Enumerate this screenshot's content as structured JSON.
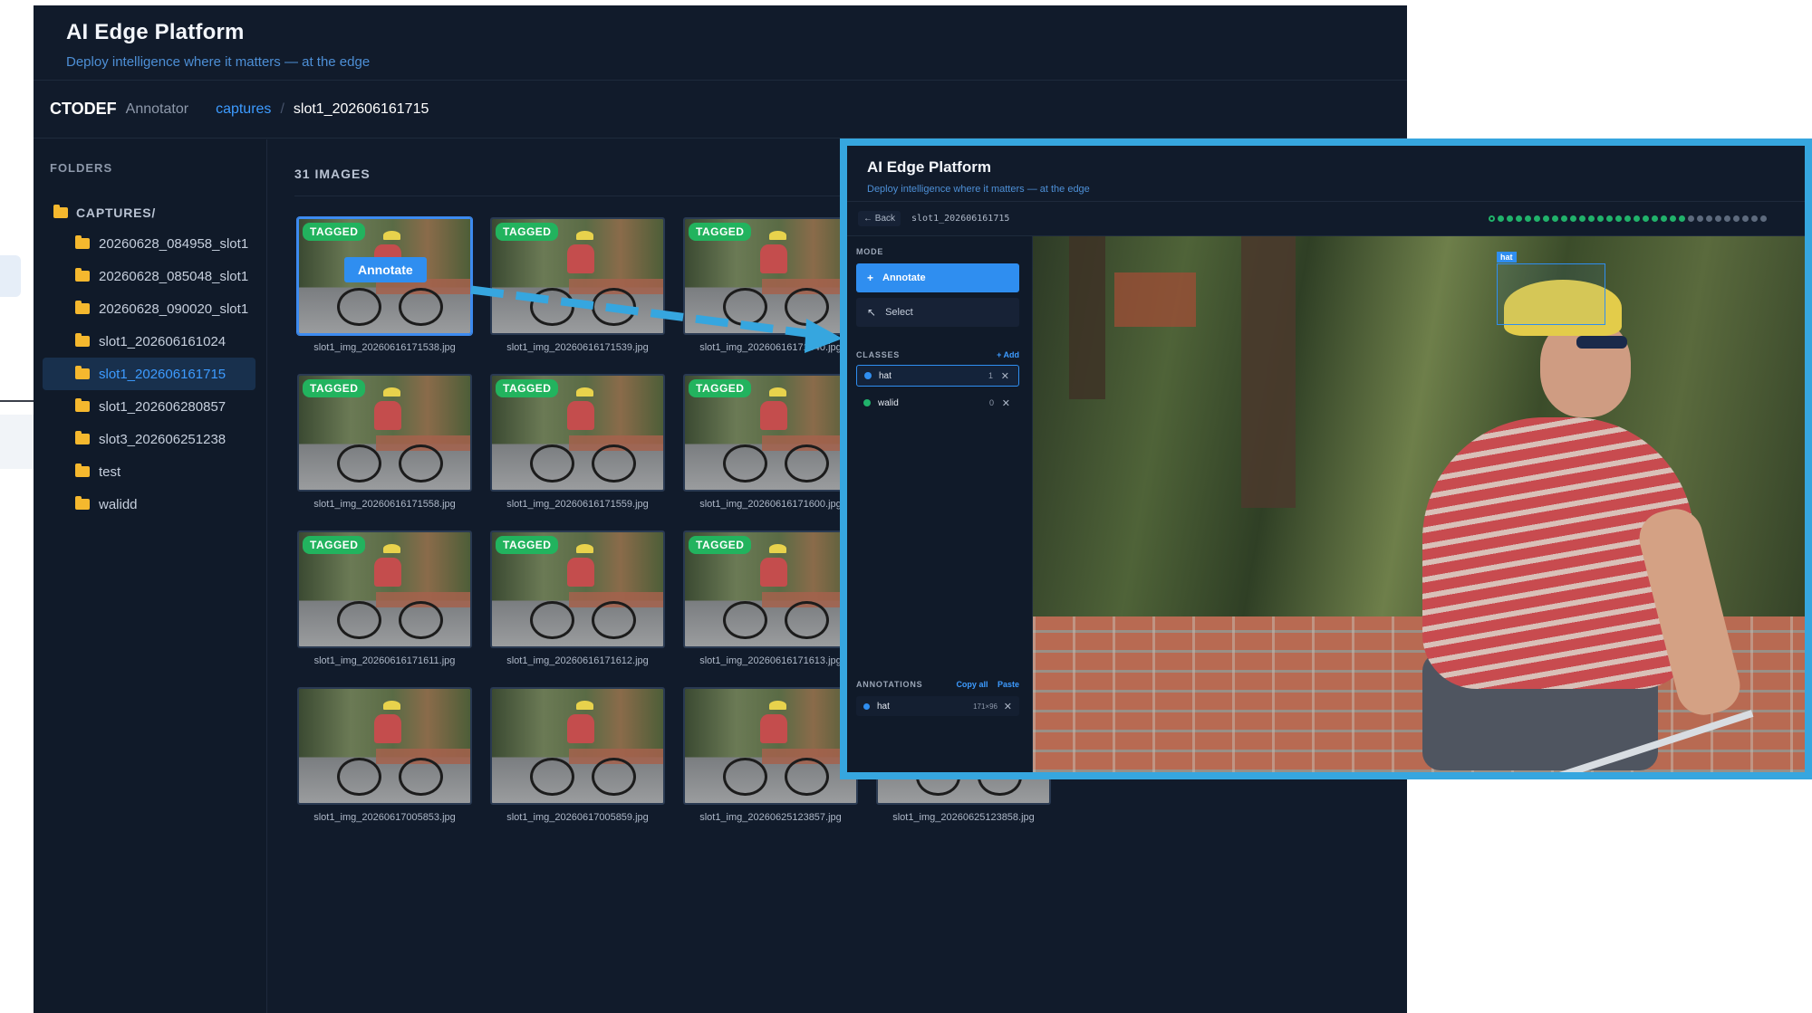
{
  "app": {
    "title": "AI Edge Platform",
    "subtitle": "Deploy intelligence where it matters — at the edge"
  },
  "crumbs": {
    "brand": "CTODEF",
    "brand_sub": "Annotator",
    "link": "captures",
    "separator": "/",
    "current": "slot1_202606161715"
  },
  "sidebar": {
    "heading": "FOLDERS",
    "root": "CAPTURES/",
    "folders": [
      {
        "label": "20260628_084958_slot1"
      },
      {
        "label": "20260628_085048_slot1"
      },
      {
        "label": "20260628_090020_slot1"
      },
      {
        "label": "slot1_202606161024"
      },
      {
        "label": "slot1_202606161715",
        "active": true
      },
      {
        "label": "slot1_202606280857"
      },
      {
        "label": "slot3_202606251238"
      },
      {
        "label": "test"
      },
      {
        "label": "walidd"
      }
    ]
  },
  "gallery": {
    "heading": "31 IMAGES",
    "badge": "TAGGED",
    "tooltip": "Annotate",
    "thumbs": [
      {
        "name": "slot1_img_20260616171538.jpg",
        "tagged": true
      },
      {
        "name": "slot1_img_20260616171539.jpg",
        "tagged": true
      },
      {
        "name": "slot1_img_20260616171540.jpg",
        "tagged": true
      },
      {
        "name": "",
        "tagged": false
      },
      {
        "name": "slot1_img_20260616171558.jpg",
        "tagged": true
      },
      {
        "name": "slot1_img_20260616171559.jpg",
        "tagged": true
      },
      {
        "name": "slot1_img_20260616171600.jpg",
        "tagged": true
      },
      {
        "name": "",
        "tagged": false
      },
      {
        "name": "slot1_img_20260616171611.jpg",
        "tagged": true
      },
      {
        "name": "slot1_img_20260616171612.jpg",
        "tagged": true
      },
      {
        "name": "slot1_img_20260616171613.jpg",
        "tagged": true
      },
      {
        "name": "",
        "tagged": false
      },
      {
        "name": "slot1_img_20260617005853.jpg",
        "tagged": false
      },
      {
        "name": "slot1_img_20260617005859.jpg",
        "tagged": false
      },
      {
        "name": "slot1_img_20260625123857.jpg",
        "tagged": false
      },
      {
        "name": "slot1_img_20260625123858.jpg",
        "tagged": false
      }
    ]
  },
  "annotator": {
    "title": "AI Edge Platform",
    "subtitle": "Deploy intelligence where it matters — at the edge",
    "back": "← Back",
    "slot": "slot1_202606161715",
    "progress_total": 31,
    "progress_done": 22,
    "progress_current": 0,
    "mode_heading": "MODE",
    "mode_annotate": "Annotate",
    "mode_select": "Select",
    "classes_heading": "CLASSES",
    "add_label": "+ Add",
    "classes": [
      {
        "name": "hat",
        "count": "1",
        "color": "#2f8ef0",
        "active": true
      },
      {
        "name": "walid",
        "count": "0",
        "color": "#21b26b",
        "active": false
      }
    ],
    "annotations_heading": "ANNOTATIONS",
    "copy_all": "Copy all",
    "paste": "Paste",
    "annotations": [
      {
        "class": "hat",
        "size": "171×96"
      }
    ],
    "bbox_label": "hat"
  },
  "colors": {
    "accent": "#2f8ef0",
    "tagged": "#22b35e",
    "overlay_border": "#36a6df",
    "folder": "#f5b82e"
  }
}
